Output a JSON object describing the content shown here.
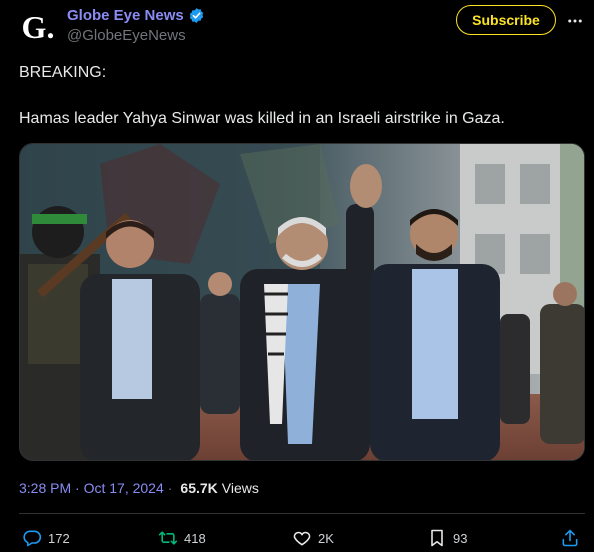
{
  "author": {
    "avatar_letter": "G.",
    "display_name": "Globe Eye News",
    "handle": "@GlobeEyeNews",
    "verified": true
  },
  "subscribe_label": "Subscribe",
  "tweet": {
    "line1": "BREAKING:",
    "line2": "Hamas leader Yahya Sinwar was killed in an Israeli airstrike in Gaza."
  },
  "meta": {
    "time": "3:28 PM · Oct 17, 2024",
    "separator": "·",
    "views_count": "65.7K",
    "views_label": "Views"
  },
  "actions": {
    "replies": "172",
    "reposts": "418",
    "likes": "2K",
    "bookmarks": "93"
  },
  "colors": {
    "background": "#000000",
    "name_accent": "#8a8cf2",
    "verified": "#1d9bf0",
    "subscribe": "#fbe426",
    "muted": "#71767b",
    "text": "#e7e9ea"
  },
  "icons": {
    "more": "more-icon",
    "reply": "reply-icon",
    "repost": "repost-icon",
    "like": "heart-icon",
    "bookmark": "bookmark-icon",
    "share": "share-icon"
  }
}
